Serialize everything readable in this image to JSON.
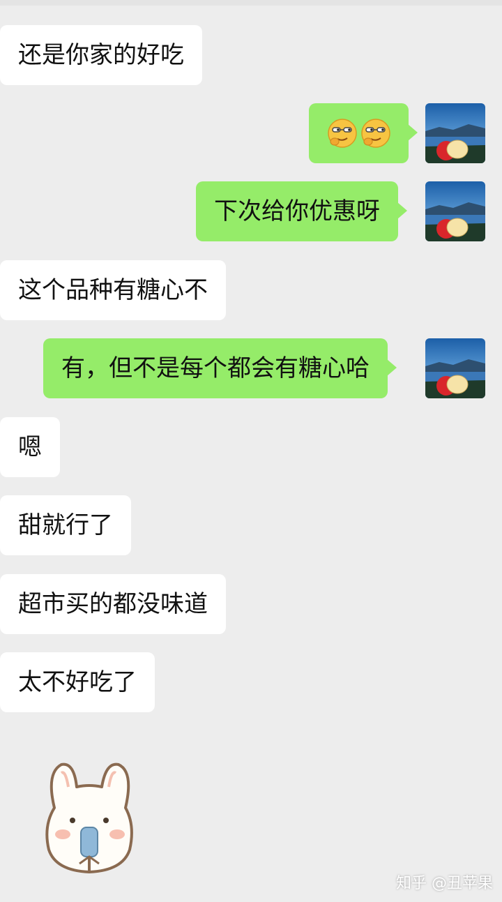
{
  "messages": [
    {
      "side": "in",
      "text": "还是你家的好吃"
    },
    {
      "side": "out",
      "type": "emoji",
      "emoji_name": "smirk-glasses-emoji",
      "count": 2
    },
    {
      "side": "out",
      "text": "下次给你优惠呀"
    },
    {
      "side": "in",
      "text": "这个品种有糖心不"
    },
    {
      "side": "out",
      "text": "有，但不是每个都会有糖心哈"
    },
    {
      "side": "in",
      "text": "嗯"
    },
    {
      "side": "in",
      "text": "甜就行了"
    },
    {
      "side": "in",
      "text": "超市买的都没味道"
    },
    {
      "side": "in",
      "text": "太不好吃了"
    },
    {
      "side": "in",
      "type": "sticker",
      "sticker_name": "bunny-popsicle-sticker"
    }
  ],
  "watermark": "知乎 @丑苹果",
  "colors": {
    "background": "#ededed",
    "incoming_bubble": "#ffffff",
    "outgoing_bubble": "#95ec69"
  },
  "icons": {
    "self_avatar": "apple-lake-avatar"
  }
}
